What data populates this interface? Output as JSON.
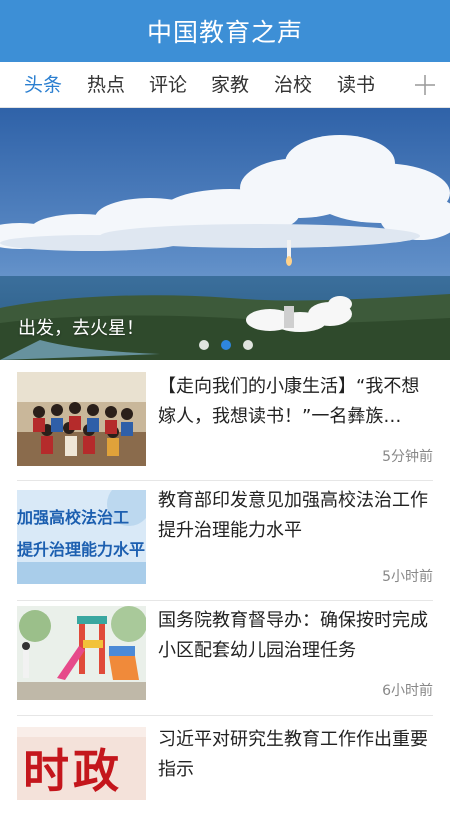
{
  "app": {
    "title": "中国教育之声"
  },
  "tabs": [
    {
      "label": "头条",
      "active": true
    },
    {
      "label": "热点",
      "active": false
    },
    {
      "label": "评论",
      "active": false
    },
    {
      "label": "家教",
      "active": false
    },
    {
      "label": "治校",
      "active": false
    },
    {
      "label": "读书",
      "active": false
    }
  ],
  "tab_add_icon": "plus-icon",
  "banner": {
    "caption": "出发，去火星！",
    "slide_count": 3,
    "active_slide": 2
  },
  "news": [
    {
      "title": "【走向我们的小康生活】“我不想嫁人，我想读书！”一名彝族…",
      "time": "5分钟前"
    },
    {
      "title": "教育部印发意见加强高校法治工作提升治理能力水平",
      "time": "5小时前",
      "thumb_text": [
        "加强高校法治工",
        "提升治理能力水平"
      ]
    },
    {
      "title": "国务院教育督导办：确保按时完成小区配套幼儿园治理任务",
      "time": "6小时前"
    },
    {
      "title": "习近平对研究生教育工作作出重要指示",
      "time": "",
      "thumb_text": [
        "时政"
      ]
    }
  ],
  "colors": {
    "brand": "#3d8fd6",
    "active_tab": "#2b7fd0",
    "time_text": "#888888"
  }
}
